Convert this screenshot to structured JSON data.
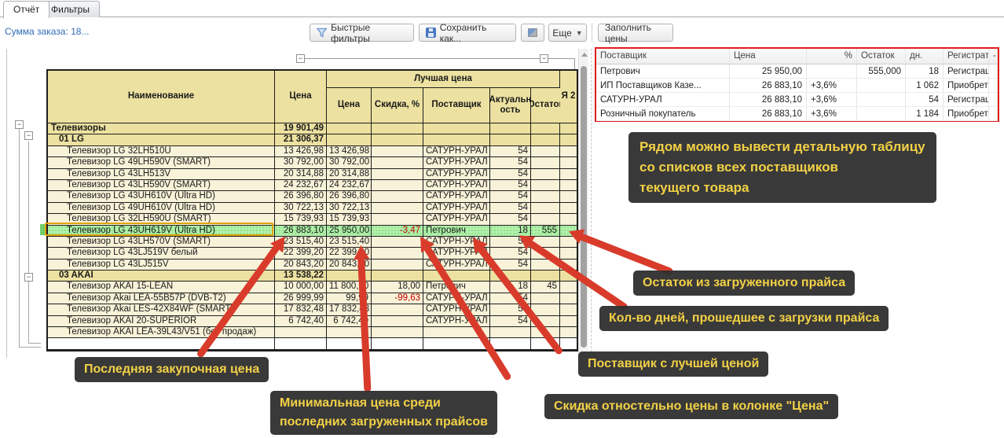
{
  "tabs": [
    {
      "label": "Отчёт",
      "active": true
    },
    {
      "label": "Фильтры",
      "active": false
    }
  ],
  "order_sum_label": "Сумма заказа: 18...",
  "toolbar": {
    "quick_filters": "Быстрые фильтры",
    "save_as": "Сохранить как...",
    "more": "Еще",
    "more_arrow": "▼",
    "fill_prices": "Заполнить цены"
  },
  "report": {
    "header": {
      "name": "Наименование",
      "price": "Цена",
      "best_group": "Лучшая цена",
      "best_price": "Цена",
      "discount": "Скидка, %",
      "supplier": "Поставщик",
      "actuality": "Актуальн ость",
      "stock": "Остаток",
      "partial": "Я 2"
    },
    "rows": [
      {
        "type": "group",
        "level": 0,
        "name": "Телевизоры",
        "price": "19 901,49"
      },
      {
        "type": "group",
        "level": 1,
        "name": "01 LG",
        "price": "21 306,37"
      },
      {
        "type": "item",
        "name": "Телевизор LG 32LH510U",
        "price": "13 426,98",
        "best": "13 426,98",
        "disc": "",
        "supplier": "САТУРН-УРАЛ",
        "days": "54",
        "stock": ""
      },
      {
        "type": "item",
        "name": "Телевизор LG 49LH590V (SMART)",
        "price": "30 792,00",
        "best": "30 792,00",
        "disc": "",
        "supplier": "САТУРН-УРАЛ",
        "days": "54",
        "stock": ""
      },
      {
        "type": "item",
        "name": "Телевизор LG 43LH513V",
        "price": "20 314,88",
        "best": "20 314,88",
        "disc": "",
        "supplier": "САТУРН-УРАЛ",
        "days": "54",
        "stock": ""
      },
      {
        "type": "item",
        "name": "Телевизор LG 43LH590V (SMART)",
        "price": "24 232,67",
        "best": "24 232,67",
        "disc": "",
        "supplier": "САТУРН-УРАЛ",
        "days": "54",
        "stock": ""
      },
      {
        "type": "item",
        "name": "Телевизор LG 43UH610V (Ultra HD)",
        "price": "26 396,80",
        "best": "26 396,80",
        "disc": "",
        "supplier": "САТУРН-УРАЛ",
        "days": "54",
        "stock": ""
      },
      {
        "type": "item",
        "name": "Телевизор LG 49UH610V (Ultra HD)",
        "price": "30 722,13",
        "best": "30 722,13",
        "disc": "",
        "supplier": "САТУРН-УРАЛ",
        "days": "54",
        "stock": ""
      },
      {
        "type": "item",
        "name": "Телевизор LG 32LH590U (SMART)",
        "price": "15 739,93",
        "best": "15 739,93",
        "disc": "",
        "supplier": "САТУРН-УРАЛ",
        "days": "54",
        "stock": ""
      },
      {
        "type": "item",
        "selected": true,
        "name": "Телевизор LG 43UH619V (Ultra HD)",
        "price": "26 883,10",
        "best": "25 950,00",
        "disc": "-3,47",
        "supplier": "Петрович",
        "days": "18",
        "stock": "555"
      },
      {
        "type": "item",
        "name": "Телевизор LG 43LH570V (SMART)",
        "price": "23 515,40",
        "best": "23 515,40",
        "disc": "",
        "supplier": "САТУРН-УРАЛ",
        "days": "54",
        "stock": ""
      },
      {
        "type": "item",
        "name": "Телевизор LG 43LJ519V белый",
        "price": "22 399,20",
        "best": "22 399,20",
        "disc": "",
        "supplier": "САТУРН-УРАЛ",
        "days": "54",
        "stock": ""
      },
      {
        "type": "item",
        "name": "Телевизор LG 43LJ515V",
        "price": "20 843,20",
        "best": "20 843,20",
        "disc": "",
        "supplier": "САТУРН-УРАЛ",
        "days": "54",
        "stock": ""
      },
      {
        "type": "group",
        "level": 1,
        "name": "03 AKAI",
        "price": "13 538,22"
      },
      {
        "type": "item",
        "name": "Телевизор AKAI 15-LEAN",
        "price": "10 000,00",
        "best": "11 800,00",
        "disc": "18,00",
        "supplier": "Петрович",
        "days": "18",
        "stock": "45"
      },
      {
        "type": "item",
        "name": "Телевизор Akai LEA-55B57P (DVB-T2)",
        "price": "26 999,99",
        "best": "99,99",
        "disc": "-99,63",
        "supplier": "САТУРН-УРАЛ",
        "days": "54",
        "stock": ""
      },
      {
        "type": "item",
        "name": "Телевизор Akai LES-42X84WF (SMART)",
        "price": "17 832,48",
        "best": "17 832,48",
        "disc": "",
        "supplier": "САТУРН-УРАЛ",
        "days": "54",
        "stock": ""
      },
      {
        "type": "item",
        "name": "Телевизор AKAI 20-SUPERIOR",
        "price": "6 742,40",
        "best": "6 742,40",
        "disc": "",
        "supplier": "САТУРН-УРАЛ",
        "days": "54",
        "stock": ""
      },
      {
        "type": "item",
        "name": "Телевизор AKAI LEA-39L43/V51 (без продаж)",
        "price": "",
        "best": "",
        "disc": "",
        "supplier": "",
        "days": "",
        "stock": ""
      },
      {
        "type": "empty"
      }
    ]
  },
  "panel": {
    "columns": [
      "Поставщик",
      "Цена",
      "%",
      "Остаток",
      "дн.",
      "Регистратор",
      "-"
    ],
    "rows": [
      [
        "Петрович",
        "25 950,00",
        "",
        "555,000",
        "18",
        "Регистрация ...",
        ""
      ],
      [
        "ИП Поставщиков Казе...",
        "26 883,10",
        "+3,6%",
        "",
        "1 062",
        "Приобретени...",
        ""
      ],
      [
        "САТУРН-УРАЛ",
        "26 883,10",
        "+3,6%",
        "",
        "54",
        "Регистрация ...",
        ""
      ],
      [
        "Розничный покупатель",
        "26 883,10",
        "+3,6%",
        "",
        "1 184",
        "Приобретени...",
        ""
      ]
    ]
  },
  "annotations": {
    "detail_table": {
      "lines": [
        "Рядом можно вывести детальную таблицу",
        "со списков всех поставщиков",
        "текущего товара"
      ]
    },
    "stock": "Остаток из загруженного прайса",
    "days": "Кол-во дней, прошедшее с загрузки прайса",
    "supplier": "Поставщик с лучшей ценой",
    "discount": "Скидка отностельно цены в колонке \"Цена\"",
    "last_price": "Последняя закупочная цена",
    "min_price": {
      "lines": [
        "Минимальная цена среди",
        "последних загруженных прайсов"
      ]
    }
  },
  "colors": {
    "group_row": "#ece1a0",
    "item_row": "#f8f2d8",
    "accent_green": "#b5f1af",
    "selection": "#e2a400",
    "arrow": "#d93b2b",
    "annotation_bg": "#2f2f2f",
    "annotation_text": "#f2cf3d",
    "panel_border": "#e11c1c",
    "link_blue": "#2f6db5",
    "neg_red": "#c00000"
  }
}
